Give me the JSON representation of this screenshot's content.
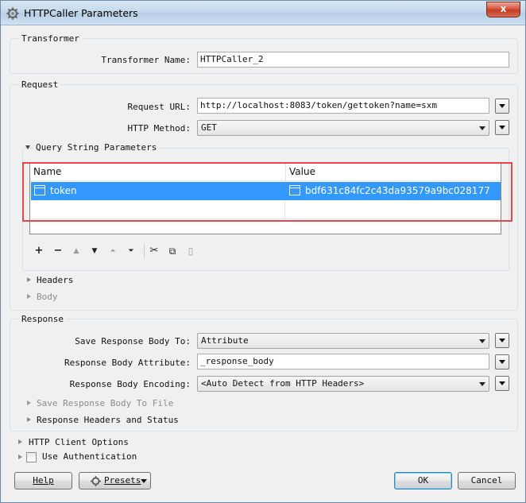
{
  "window": {
    "title": "HTTPCaller Parameters",
    "close_label": "x"
  },
  "transformer": {
    "group_label": "Transformer",
    "name_label": "Transformer Name:",
    "name_value": "HTTPCaller_2"
  },
  "request": {
    "group_label": "Request",
    "url_label": "Request URL:",
    "url_value": "http://localhost:8083/token/gettoken?name=sxm",
    "method_label": "HTTP Method:",
    "method_value": "GET",
    "query_section_label": "Query String Parameters",
    "table": {
      "columns": [
        "Name",
        "Value"
      ],
      "rows": [
        {
          "name": "token",
          "value": "bdf631c84fc2c43da93579a9bc028177"
        }
      ]
    },
    "headers_label": "Headers",
    "body_label": "Body"
  },
  "response": {
    "group_label": "Response",
    "save_to_label": "Save Response Body To:",
    "save_to_value": "Attribute",
    "attribute_label": "Response Body Attribute:",
    "attribute_value": "_response_body",
    "encoding_label": "Response Body Encoding:",
    "encoding_value": "<Auto Detect from HTTP Headers>",
    "save_to_file_label": "Save Response Body To File",
    "headers_status_label": "Response Headers and Status"
  },
  "http_client_options_label": "HTTP Client Options",
  "use_authentication_label": "Use Authentication",
  "buttons": {
    "help": "Help",
    "presets": "Presets",
    "ok": "OK",
    "cancel": "Cancel"
  },
  "toolbar_icons": [
    "plus-icon",
    "minus-icon",
    "move-up-icon",
    "move-down-icon",
    "move-top-icon",
    "move-bottom-icon",
    "cut-icon",
    "copy-icon",
    "paste-icon"
  ],
  "colors": {
    "selection": "#3399ff",
    "highlight_border": "#e8454f",
    "titlebar": "#c5d8ec"
  }
}
